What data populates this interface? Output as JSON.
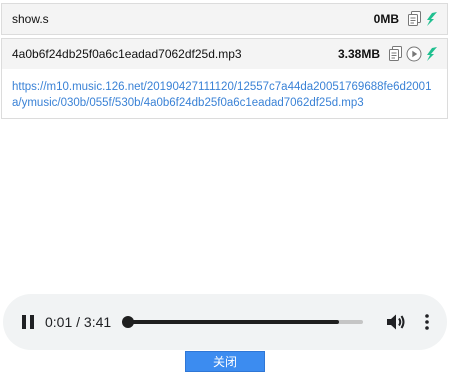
{
  "files": [
    {
      "name": "show.s",
      "size": "0MB",
      "icons": [
        "copy-icon",
        "download-icon"
      ]
    },
    {
      "name": "4a0b6f24db25f0a6c1eadad7062df25d.mp3",
      "size": "3.38MB",
      "icons": [
        "copy-icon",
        "play-icon",
        "download-icon"
      ],
      "url": "https://m10.music.126.net/20190427111120/12557c7a44da20051769688fe6d2001a/ymusic/030b/055f/530b/4a0b6f24db25f0a6c1eadad7062df25d.mp3"
    }
  ],
  "player": {
    "time": "0:01 / 3:41",
    "progress": 0.0045,
    "volume_progress_fill": 0.9
  },
  "close_button": {
    "label": "关闭"
  },
  "colors": {
    "accent": "#3c8cf0",
    "download_green": "#1fbf8f",
    "link": "#3a82d6"
  }
}
